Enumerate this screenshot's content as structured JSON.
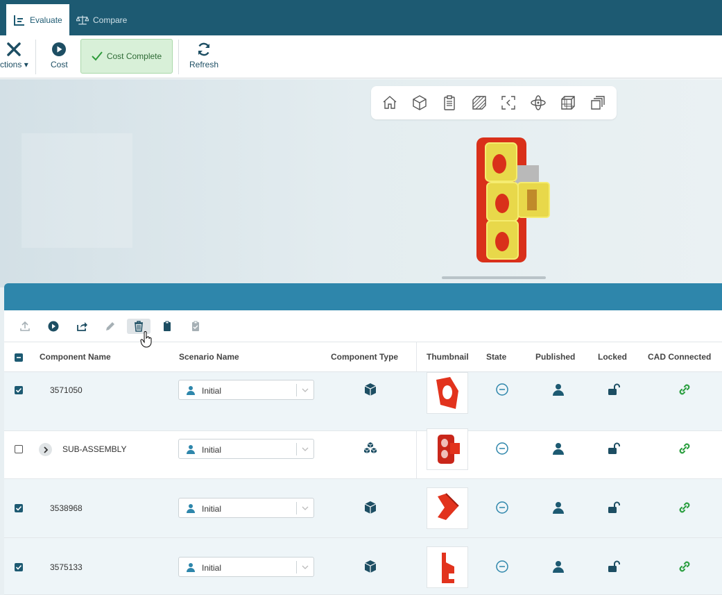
{
  "tabs": [
    {
      "label": "Evaluate",
      "icon": "chart-icon",
      "active": true
    },
    {
      "label": "Compare",
      "icon": "scale-icon",
      "active": false
    }
  ],
  "toolbar": {
    "actions_label": "ctions",
    "cost_label": "Cost",
    "cost_complete_label": "Cost Complete",
    "refresh_label": "Refresh"
  },
  "viewer_tools": [
    "home-view-icon",
    "cube-view-icon",
    "clipboard-icon",
    "hatch-section-icon",
    "fit-view-icon",
    "orbit-icon",
    "wireframe-icon",
    "exploded-view-icon"
  ],
  "table": {
    "columns": [
      "Component Name",
      "Scenario Name",
      "Component Type",
      "Thumbnail",
      "State",
      "Published",
      "Locked",
      "CAD Connected"
    ],
    "rows": [
      {
        "name": "3571050",
        "scenario": "Initial",
        "checked": true,
        "type": "part-icon",
        "expandable": false
      },
      {
        "name": "SUB-ASSEMBLY",
        "scenario": "Initial",
        "checked": false,
        "type": "assembly-icon",
        "expandable": true
      },
      {
        "name": "3538968",
        "scenario": "Initial",
        "checked": true,
        "type": "part-icon",
        "expandable": false
      },
      {
        "name": "3575133",
        "scenario": "Initial",
        "checked": true,
        "type": "part-icon",
        "expandable": false
      }
    ]
  },
  "colors": {
    "header_bg": "#1d5a72",
    "panel_head_bg": "#2e86ab",
    "success_bg": "#d8f0d8",
    "link_green": "#2ea043",
    "part_red": "#e2331d"
  }
}
